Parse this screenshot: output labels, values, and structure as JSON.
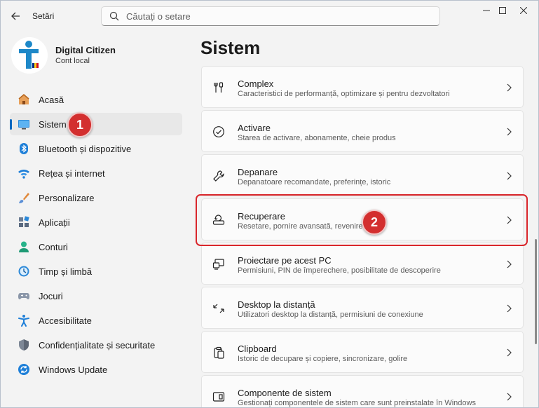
{
  "app": {
    "title": "Setări"
  },
  "search": {
    "placeholder": "Căutați o setare"
  },
  "window_controls": {
    "minimize": "—",
    "maximize": "☐",
    "close": "✕"
  },
  "profile": {
    "name": "Digital Citizen",
    "account_type": "Cont local"
  },
  "sidebar": {
    "items": [
      {
        "label": "Acasă",
        "icon": "home-icon",
        "active": false
      },
      {
        "label": "Sistem",
        "icon": "system-display-icon",
        "active": true
      },
      {
        "label": "Bluetooth și dispozitive",
        "icon": "bluetooth-icon",
        "active": false
      },
      {
        "label": "Rețea și internet",
        "icon": "wifi-icon",
        "active": false
      },
      {
        "label": "Personalizare",
        "icon": "paintbrush-icon",
        "active": false
      },
      {
        "label": "Aplicații",
        "icon": "apps-icon",
        "active": false
      },
      {
        "label": "Conturi",
        "icon": "account-icon",
        "active": false
      },
      {
        "label": "Timp și limbă",
        "icon": "time-language-icon",
        "active": false
      },
      {
        "label": "Jocuri",
        "icon": "gamepad-icon",
        "active": false
      },
      {
        "label": "Accesibilitate",
        "icon": "accessibility-icon",
        "active": false
      },
      {
        "label": "Confidențialitate și securitate",
        "icon": "shield-icon",
        "active": false
      },
      {
        "label": "Windows Update",
        "icon": "windows-update-icon",
        "active": false
      }
    ]
  },
  "main": {
    "title": "Sistem",
    "cards": [
      {
        "title": "Complex",
        "description": "Caracteristici de performanță, optimizare și pentru dezvoltatori",
        "icon": "developer-tools-icon"
      },
      {
        "title": "Activare",
        "description": "Starea de activare, abonamente, cheie produs",
        "icon": "check-circle-icon"
      },
      {
        "title": "Depanare",
        "description": "Depanatoare recomandate, preferințe, istoric",
        "icon": "wrench-icon"
      },
      {
        "title": "Recuperare",
        "description": "Resetare, pornire avansată, revenire",
        "icon": "recovery-icon"
      },
      {
        "title": "Proiectare pe acest PC",
        "description": "Permisiuni, PIN de împerechere, posibilitate de descoperire",
        "icon": "projection-icon"
      },
      {
        "title": "Desktop la distanță",
        "description": "Utilizatori desktop la distanță, permisiuni de conexiune",
        "icon": "remote-desktop-icon"
      },
      {
        "title": "Clipboard",
        "description": "Istoric de decupare și copiere, sincronizare, golire",
        "icon": "clipboard-icon"
      },
      {
        "title": "Componente de sistem",
        "description": "Gestionați componentele de sistem care sunt preinstalate în Windows",
        "icon": "system-components-icon"
      }
    ]
  },
  "annotations": {
    "badge_1": "1",
    "badge_2": "2"
  },
  "colors": {
    "accent": "#0067c0",
    "annotation_red": "#d32f2f"
  }
}
